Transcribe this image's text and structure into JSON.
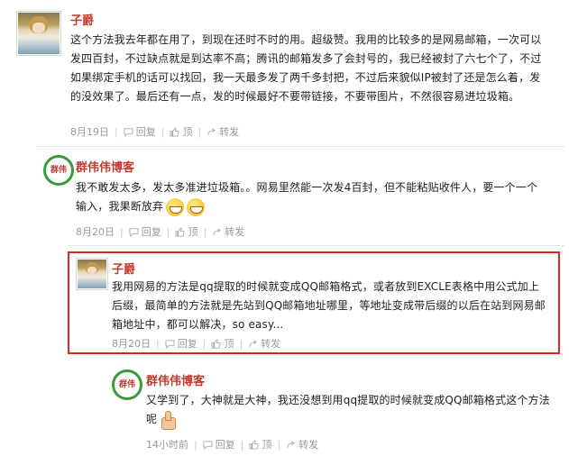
{
  "comments": [
    {
      "name": "子爵",
      "text": "这个方法我去年都在用了，到现在还时不时的用。超级赞。我用的比较多的是网易邮箱，一次可以发四百封，不过缺点就是到达率不高；腾讯的邮箱发多了会封号的，我已经被封了六七个了，不过如果绑定手机的话可以找回，我一天最多发了两千多封把，不过后来貌似IP被封了还是怎么着，发的没效果了。最后还有一点，发的时候最好不要带链接，不要带图片，不然很容易进垃圾箱。",
      "time": "8月19日",
      "reply": "回复",
      "top": "顶",
      "forward": "转发"
    },
    {
      "name": "群伟伟博客",
      "avatar_text": "群伟",
      "text": "我不敢发太多，发太多准进垃圾箱。。网易里然能一次发4百封，但不能粘贴收件人，要一个一个输入，我果断放弃",
      "emoji": "grin-emoji",
      "time": "8月20日",
      "reply": "回复",
      "top": "顶",
      "forward": "转发"
    },
    {
      "name": "子爵",
      "text": "我用网易的方法是qq提取的时候就变成QQ邮箱格式，或者放到EXCLE表格中用公式加上后缀，最简单的方法就是先站到QQ邮箱地址哪里，等地址变成带后缀的以后在站到网易邮箱地址中，都可以解决，so easy...",
      "time": "8月20日",
      "reply": "回复",
      "top": "顶",
      "forward": "转发",
      "highlight_color": "#e1251b"
    },
    {
      "name": "群伟伟博客",
      "avatar_text": "群伟",
      "text": "又学到了，大神就是大神，我还没想到用qq提取的时候就变成QQ邮箱格式这个方法呢",
      "emoji": "thumbs-up-emoji",
      "time": "14小时前",
      "reply": "回复",
      "top": "顶",
      "forward": "转发"
    }
  ],
  "colors": {
    "name": "#c0392b",
    "meta": "#999999",
    "highlight": "#e1251b"
  }
}
